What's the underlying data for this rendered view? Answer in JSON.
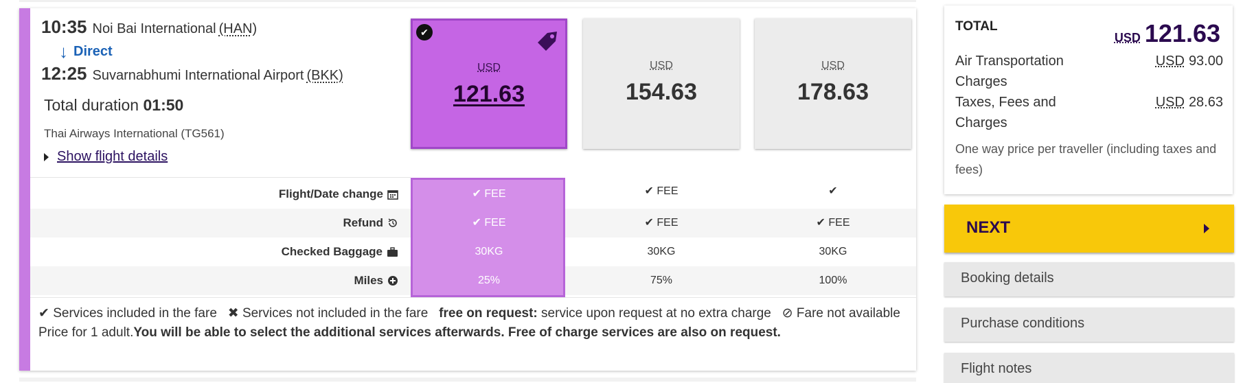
{
  "flight": {
    "departure": {
      "time": "10:35",
      "airport": "Noi Bai International",
      "code": "(HAN)"
    },
    "stops_label": "Direct",
    "arrival": {
      "time": "12:25",
      "airport": "Suvarnabhumi International Airport",
      "code": "(BKK)"
    },
    "duration_label": "Total duration",
    "duration": "01:50",
    "carrier": "Thai Airways International (TG561)",
    "details_link": "Show flight details"
  },
  "fares": [
    {
      "currency": "USD",
      "amount": "121.63",
      "selected": true
    },
    {
      "currency": "USD",
      "amount": "154.63",
      "selected": false
    },
    {
      "currency": "USD",
      "amount": "178.63",
      "selected": false
    }
  ],
  "features": [
    {
      "label": "Flight/Date change",
      "icon": "calendar-icon",
      "values": [
        "✔ FEE",
        "✔ FEE",
        "✔"
      ]
    },
    {
      "label": "Refund",
      "icon": "refund-icon",
      "values": [
        "✔ FEE",
        "✔ FEE",
        "✔ FEE"
      ]
    },
    {
      "label": "Checked Baggage",
      "icon": "baggage-icon",
      "values": [
        "30KG",
        "30KG",
        "30KG"
      ]
    },
    {
      "label": "Miles",
      "icon": "plus-circle-icon",
      "values": [
        "25%",
        "75%",
        "100%"
      ]
    }
  ],
  "legend": {
    "included": "Services included in the fare",
    "not_included": "Services not included in the fare",
    "free_request_bold": "free on request:",
    "free_request_text": "service upon request at no extra charge",
    "not_available": "Fare not available",
    "price_for": "Price for 1 adult.",
    "price_note": "You will be able to select the additional services afterwards. Free of charge services are also on request."
  },
  "summary": {
    "total_label": "TOTAL",
    "total_currency": "USD",
    "total_value": "121.63",
    "lines": [
      {
        "label": "Air Transportation Charges",
        "currency": "USD",
        "value": "93.00"
      },
      {
        "label": "Taxes, Fees and Charges",
        "currency": "USD",
        "value": "28.63"
      }
    ],
    "note": "One way price per traveller (including taxes and fees)"
  },
  "next_label": "NEXT",
  "side_links": [
    "Booking details",
    "Purchase conditions",
    "Flight notes"
  ],
  "colors": {
    "selected": "#c565e4",
    "accent": "#c77be2",
    "next": "#f8c80a",
    "brand": "#2b0a4f",
    "link_blue": "#1b62b6"
  }
}
